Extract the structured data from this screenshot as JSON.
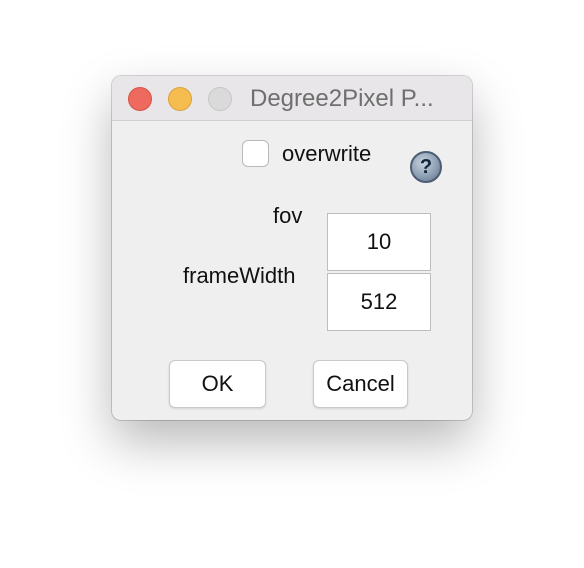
{
  "window": {
    "title": "Degree2Pixel P..."
  },
  "form": {
    "overwrite": {
      "label": "overwrite",
      "checked": false
    },
    "help_icon_glyph": "?",
    "fields": [
      {
        "label": "fov",
        "value": "10"
      },
      {
        "label": "frameWidth",
        "value": "512"
      }
    ]
  },
  "buttons": {
    "ok_label": "OK",
    "cancel_label": "Cancel"
  },
  "colors": {
    "close": "#ee6a5e",
    "minimize": "#f5bd4f",
    "zoom_disabled": "#dadada"
  },
  "icons": {
    "help": "question-mark-help-icon"
  }
}
